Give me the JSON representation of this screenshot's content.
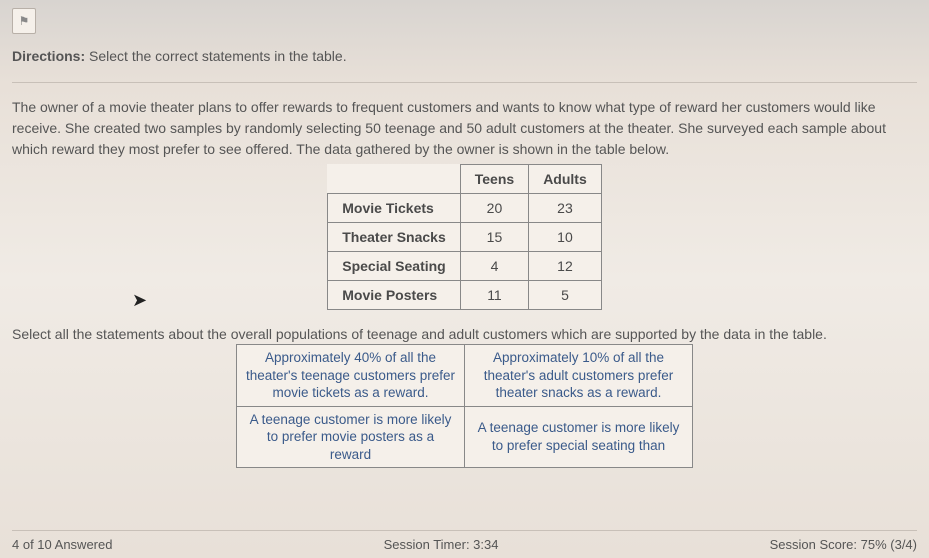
{
  "flag": {
    "glyph": "⚑"
  },
  "directions": {
    "label": "Directions:",
    "text": "Select the correct statements in the table."
  },
  "passage": "The owner of a movie theater plans to offer rewards to frequent customers and wants to know what type of reward her customers would like receive. She created two samples by randomly selecting 50 teenage and 50 adult customers at the theater. She surveyed each sample about which reward they most prefer to see offered. The data gathered by the owner is shown in the table below.",
  "table": {
    "headers": {
      "col1": "Teens",
      "col2": "Adults"
    },
    "rows": [
      {
        "label": "Movie Tickets",
        "teens": "20",
        "adults": "23"
      },
      {
        "label": "Theater Snacks",
        "teens": "15",
        "adults": "10"
      },
      {
        "label": "Special Seating",
        "teens": "4",
        "adults": "12"
      },
      {
        "label": "Movie Posters",
        "teens": "11",
        "adults": "5"
      }
    ]
  },
  "selectPrompt": "Select all the statements about the overall populations of teenage and adult customers which are supported by the data in the table.",
  "answers": {
    "a": "Approximately 40% of all the theater's teenage customers prefer movie tickets as a reward.",
    "b": "Approximately 10% of all the theater's adult customers prefer theater snacks as a reward.",
    "c": "A teenage customer is more likely to prefer movie posters as a reward",
    "d": "A teenage customer is more likely to prefer special seating than"
  },
  "footer": {
    "progress": "4 of 10 Answered",
    "timer": "Session Timer: 3:34",
    "score": "Session Score: 75% (3/4)"
  }
}
